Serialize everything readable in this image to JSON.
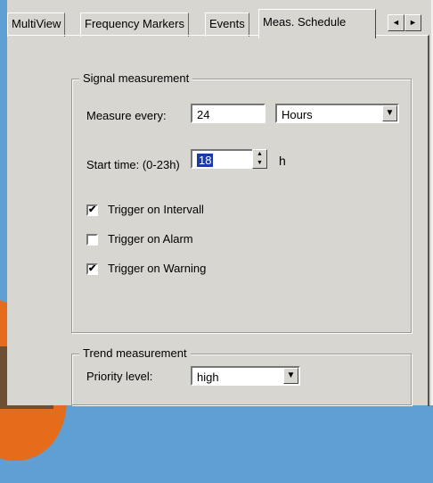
{
  "tabs": [
    {
      "label": "MultiView"
    },
    {
      "label": "Frequency Markers"
    },
    {
      "label": "Events"
    },
    {
      "label": "Meas. Schedule",
      "active": true
    }
  ],
  "tab_scroll": {
    "left": "◄",
    "right": "►"
  },
  "signal_group": {
    "legend": "Signal measurement",
    "measure_every_label": "Measure every:",
    "measure_every_value": "24",
    "unit_value": "Hours",
    "start_time_label": "Start time: (0-23h)",
    "start_time_value": "18",
    "start_time_unit": "h",
    "checkboxes": [
      {
        "label": "Trigger on Intervall",
        "checked": true,
        "mark": "✔"
      },
      {
        "label": "Trigger on Alarm",
        "checked": false,
        "mark": ""
      },
      {
        "label": "Trigger on Warning",
        "checked": true,
        "mark": "✔"
      }
    ]
  },
  "trend_group": {
    "legend": "Trend measurement",
    "priority_label": "Priority level:",
    "priority_value": "high"
  },
  "icons": {
    "dropdown": "▼",
    "spin_up": "▲",
    "spin_down": "▼"
  }
}
